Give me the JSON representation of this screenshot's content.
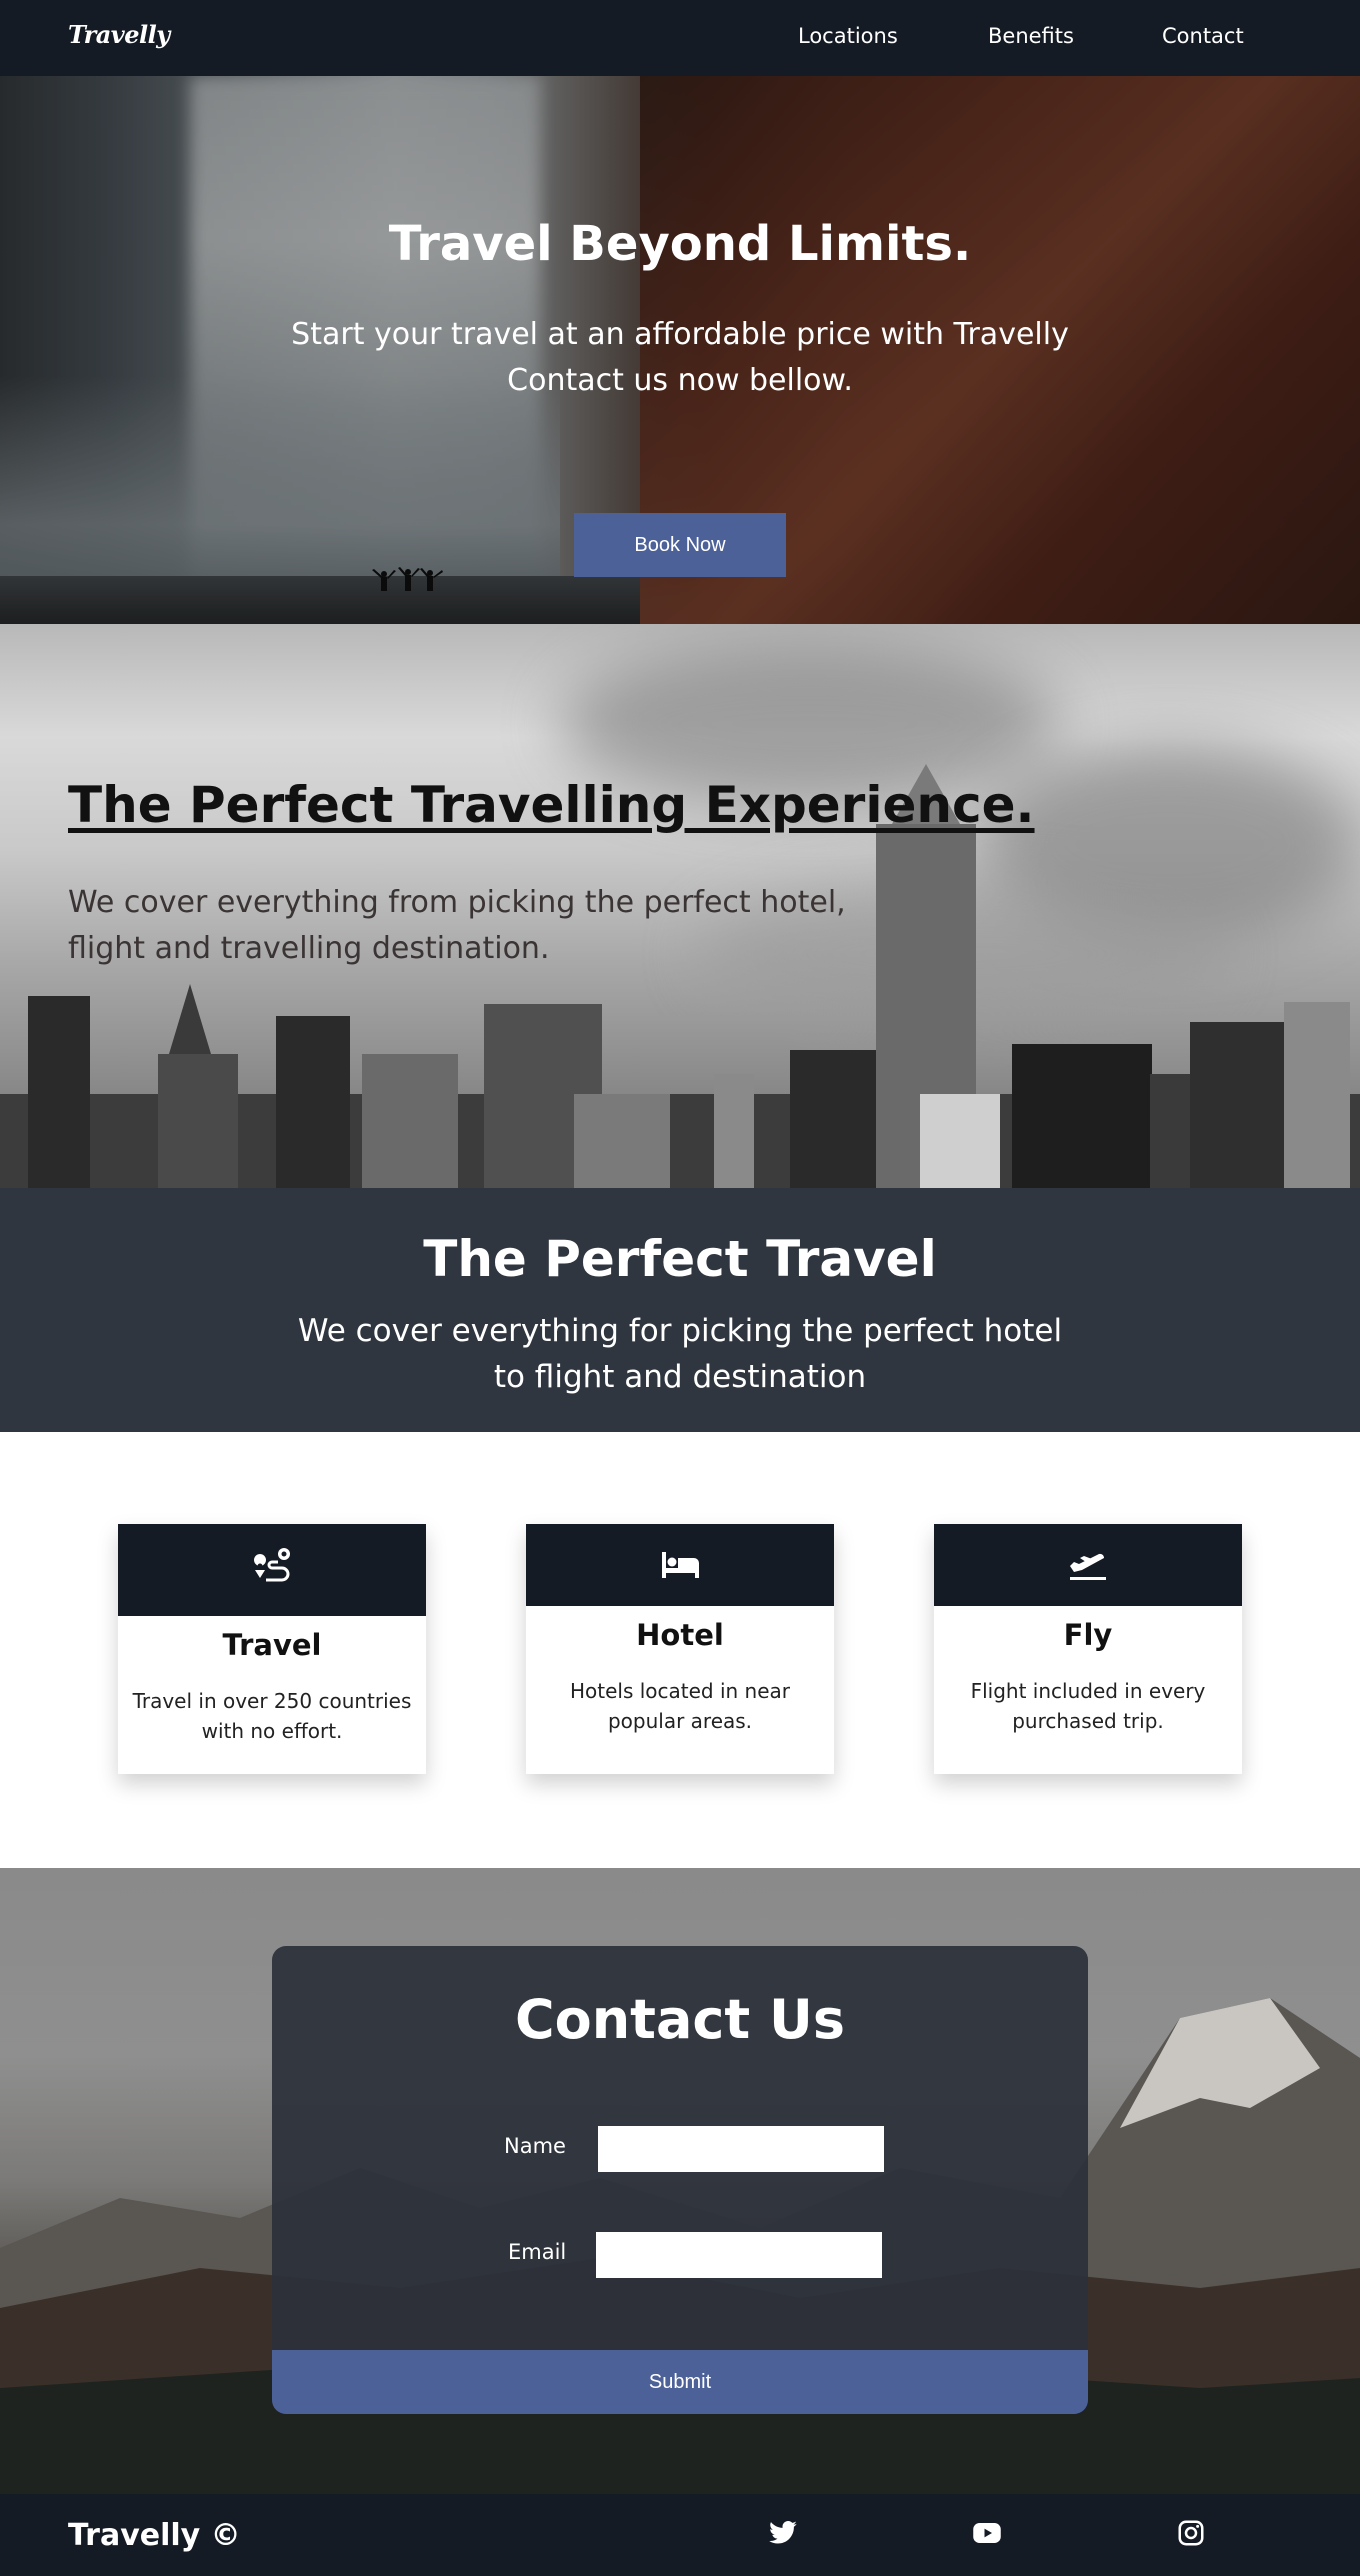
{
  "brand": "Travelly",
  "nav": {
    "links": [
      "Locations",
      "Benefits",
      "Contact"
    ]
  },
  "hero": {
    "title": "Travel Beyond Limits.",
    "subtitle_line1": "Start your travel at an affordable price with Travelly",
    "subtitle_line2": "Contact us now bellow.",
    "cta": "Book Now"
  },
  "experience": {
    "title": "The Perfect Travelling Experience.",
    "text_line1": "We cover everything from picking the perfect hotel,",
    "text_line2": "flight and travelling destination."
  },
  "perfect_travel": {
    "title": "The Perfect Travel",
    "text_line1": "We cover everything for picking the perfect hotel",
    "text_line2": "to flight and destination"
  },
  "benefits": [
    {
      "icon": "route-icon",
      "title": "Travel",
      "text_line1": "Travel in over 250 countries",
      "text_line2": "with no effort."
    },
    {
      "icon": "bed-icon",
      "title": "Hotel",
      "text_line1": "Hotels located in near",
      "text_line2": "popular areas."
    },
    {
      "icon": "plane-departure-icon",
      "title": "Fly",
      "text_line1": "Flight included in every",
      "text_line2": "purchased trip."
    }
  ],
  "contact": {
    "title": "Contact Us",
    "name_label": "Name",
    "name_value": "",
    "email_label": "Email",
    "email_value": "",
    "submit": "Submit"
  },
  "footer": {
    "brand": "Travelly ©",
    "social": [
      "twitter-icon",
      "youtube-icon",
      "instagram-icon"
    ]
  },
  "colors": {
    "navbar": "#151b25",
    "accent": "#4d6199",
    "dark_section": "#2f363f"
  }
}
